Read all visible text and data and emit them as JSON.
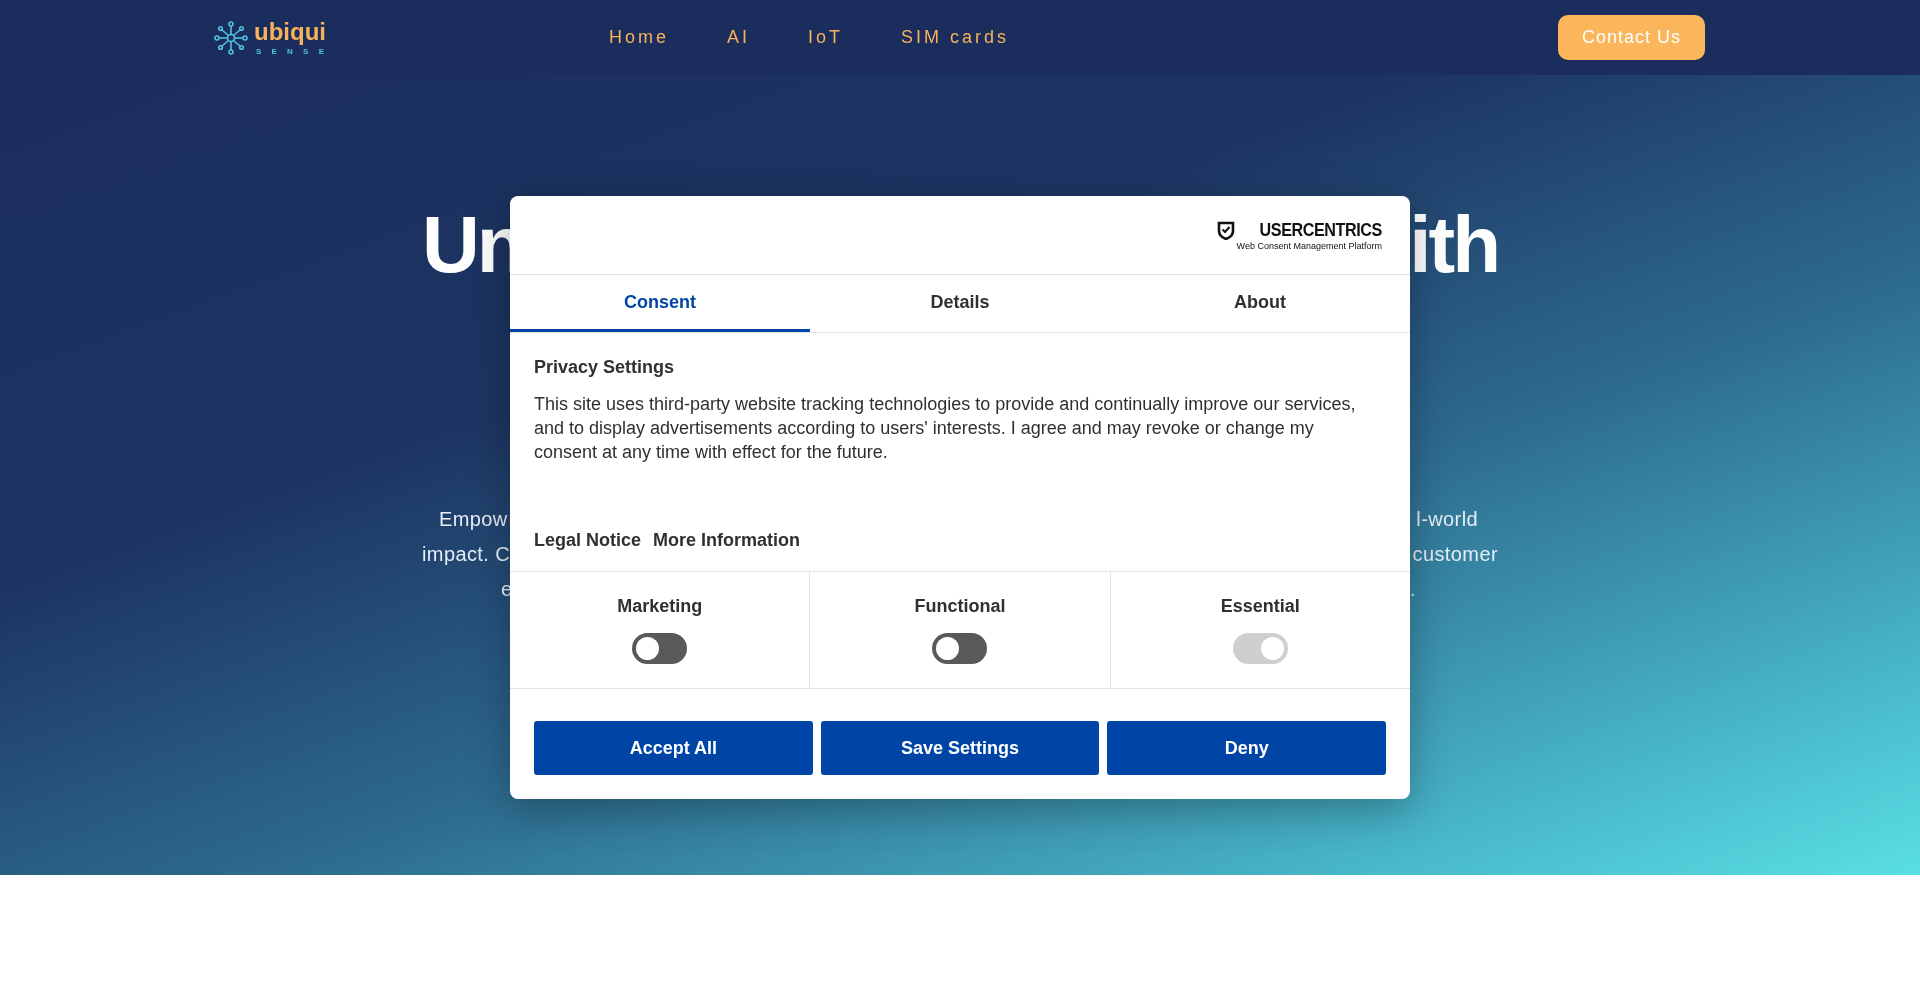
{
  "header": {
    "logo": {
      "name": "ubiqui",
      "tagline": "S E N S E"
    },
    "nav": [
      {
        "label": "Home"
      },
      {
        "label": "AI"
      },
      {
        "label": "IoT"
      },
      {
        "label": "SIM cards"
      }
    ],
    "cta": "Contact Us"
  },
  "hero": {
    "heading": {
      "left": "Un",
      "right": "ith"
    },
    "paragraph_lines": [
      {
        "left": "Empow",
        "right": "l-world"
      },
      {
        "left": "impact. C",
        "right": "customer"
      },
      {
        "left": "e",
        "right": "."
      }
    ]
  },
  "consent_dialog": {
    "brand": {
      "name": "USERCENTRICS",
      "subtitle": "Web Consent Management Platform"
    },
    "tabs": [
      {
        "label": "Consent",
        "selected": true
      },
      {
        "label": "Details",
        "selected": false
      },
      {
        "label": "About",
        "selected": false
      }
    ],
    "title": "Privacy Settings",
    "body": "This site uses third-party website tracking technologies to provide and continually improve our services, and to display advertisements according to users' interests. I agree and may revoke or change my consent at any time with effect for the future.",
    "links": [
      "Legal Notice",
      "More Information"
    ],
    "categories": [
      {
        "label": "Marketing",
        "on": false,
        "disabled": false
      },
      {
        "label": "Functional",
        "on": false,
        "disabled": false
      },
      {
        "label": "Essential",
        "on": true,
        "disabled": true
      }
    ],
    "buttons": [
      "Accept All",
      "Save Settings",
      "Deny"
    ]
  }
}
